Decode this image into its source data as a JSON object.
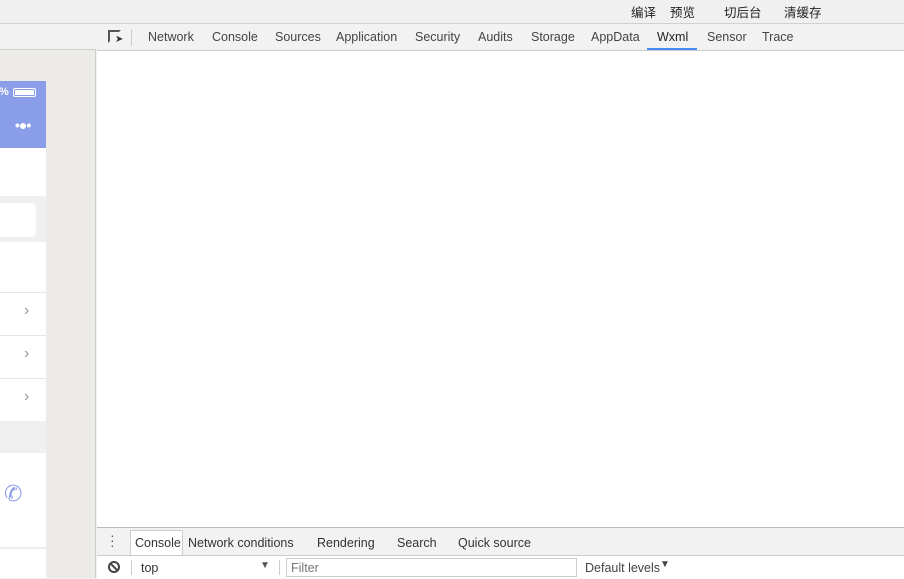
{
  "topbar": {
    "compile": "编译",
    "preview": "预览",
    "background": "切后台",
    "clear_cache": "清缓存"
  },
  "simulator": {
    "battery_text": "%"
  },
  "devtools": {
    "tabs": [
      "Network",
      "Console",
      "Sources",
      "Application",
      "Security",
      "Audits",
      "Storage",
      "AppData",
      "Wxml",
      "Sensor",
      "Trace"
    ],
    "active_tab": "Wxml"
  },
  "drawer": {
    "tabs": [
      "Console",
      "Network conditions",
      "Rendering",
      "Search",
      "Quick source"
    ],
    "active_tab": "Console",
    "context": "top",
    "filter_placeholder": "Filter",
    "levels": "Default levels"
  },
  "colors": {
    "accent": "#8a9de8",
    "active_underline": "#4a8af4"
  }
}
